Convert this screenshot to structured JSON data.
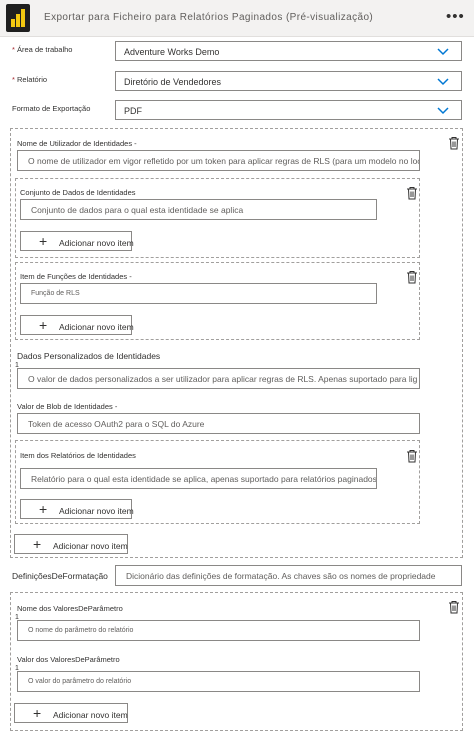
{
  "header": {
    "title": "Exportar para Ficheiro para Relatórios Paginados (Pré-visualização)",
    "more_icon": "ellipsis-icon",
    "logo_icon": "power-bi-logo"
  },
  "fields": {
    "workspace": {
      "label": "Área de trabalho",
      "required_mark": "*",
      "value": "Adventure Works Demo"
    },
    "report": {
      "label": "Relatório",
      "required_mark": "*",
      "value": "Diretório de Vendedores"
    },
    "export_format": {
      "label": "Formato de Exportação",
      "value": "PDF"
    }
  },
  "identities": {
    "username": {
      "label": "Nome de Utilizador de Identidades -",
      "placeholder": "O nome de utilizador em vigor refletido por um token para aplicar regras de RLS (para um modelo no local"
    },
    "dataset": {
      "label": "Conjunto de Dados de Identidades",
      "placeholder": "Conjunto de dados para o qual esta identidade se aplica",
      "add_label": "Adicionar novo item"
    },
    "roles": {
      "label": "Item de Funções de Identidades -",
      "placeholder": "Função de RLS",
      "add_label": "Adicionar novo item"
    },
    "custom_data": {
      "label": "Dados Personalizados de Identidades",
      "index": "1",
      "placeholder": "O valor de dados personalizados a ser utilizador para aplicar regras de RLS. Apenas suportado para lig"
    },
    "blob": {
      "label": "Valor de Blob de Identidades -",
      "placeholder": "Token de acesso OAuth2 para o SQL do Azure"
    },
    "reports": {
      "label": "Item dos Relatórios de Identidades",
      "placeholder": "Relatório para o qual esta identidade se aplica, apenas suportado para relatórios paginados",
      "add_label": "Adicionar novo item"
    },
    "add_label": "Adicionar novo item"
  },
  "format_settings": {
    "label": "DefiniçõesDeFormatação",
    "placeholder": "Dicionário das definições de formatação. As chaves são os nomes de propriedade"
  },
  "parameters": {
    "name": {
      "label": "Nome dos ValoresDeParâmetro",
      "index": "1",
      "placeholder": "O nome do parâmetro do relatório"
    },
    "value": {
      "label": "Valor dos ValoresDeParâmetro",
      "index": "1",
      "placeholder": "O valor do parâmetro do relatório"
    },
    "add_label": "Adicionar novo item"
  },
  "colors": {
    "accent": "#0078d4",
    "logo_bg": "#1f1f1f",
    "logo_bars": "#f2c811",
    "required": "#a4262c"
  }
}
